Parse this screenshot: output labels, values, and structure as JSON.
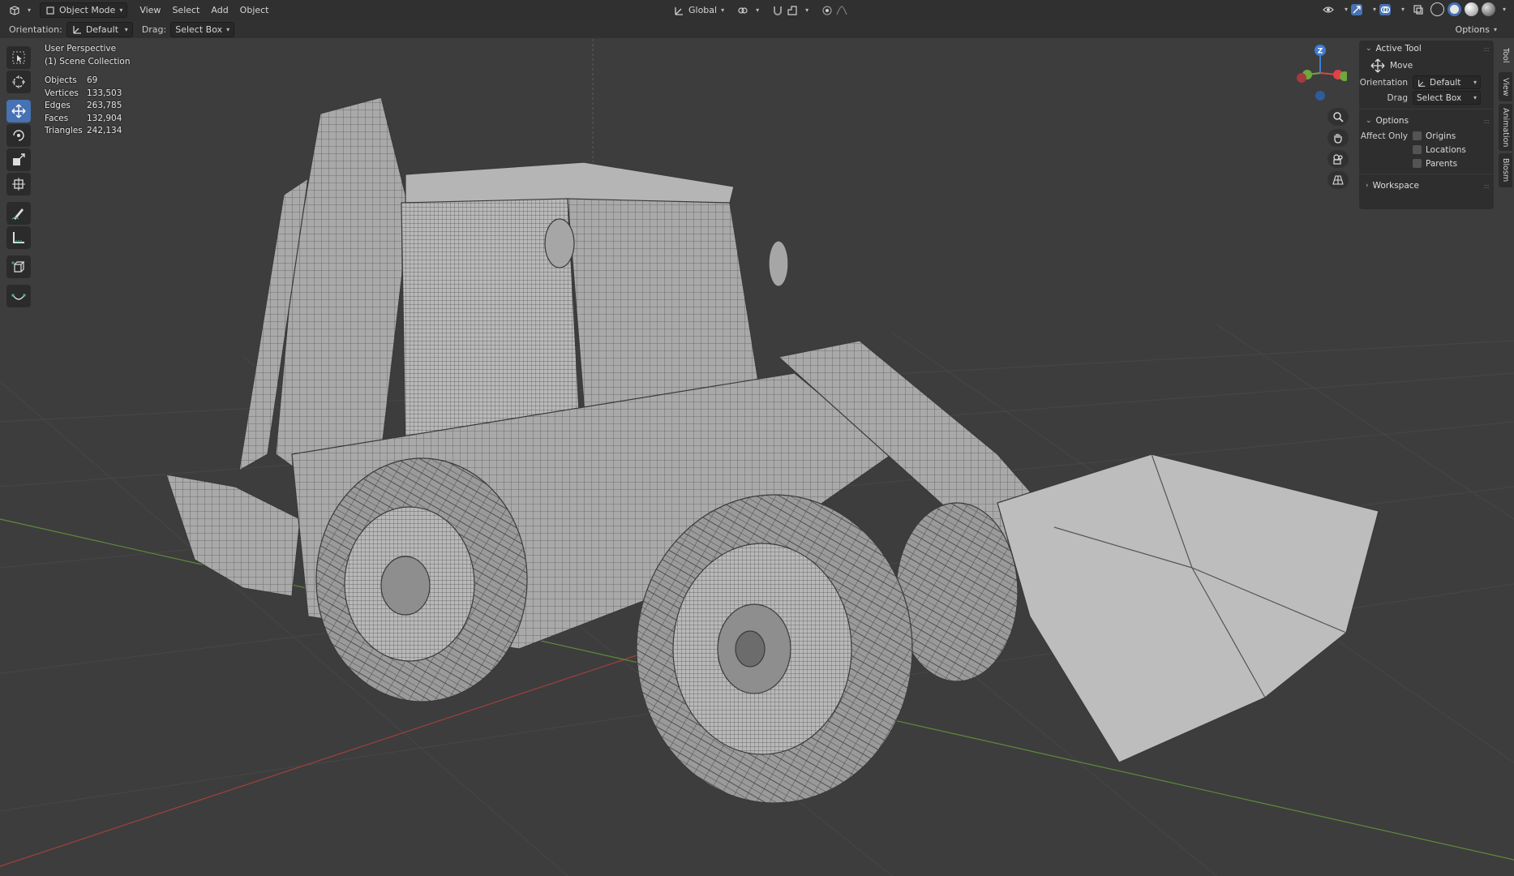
{
  "header": {
    "editor_type_icon": "3d-viewport-icon",
    "mode": "Object Mode",
    "menus": [
      "View",
      "Select",
      "Add",
      "Object"
    ],
    "transform_orientation": "Global",
    "shading_modes": [
      "wireframe",
      "solid",
      "material-preview",
      "rendered"
    ],
    "active_shading": "solid"
  },
  "tool_options": {
    "orientation_label": "Orientation:",
    "orientation_value": "Default",
    "drag_label": "Drag:",
    "drag_value": "Select Box",
    "options_label": "Options"
  },
  "toolbar": {
    "tools": [
      {
        "name": "select-box",
        "icon": "select-box-icon",
        "active": false
      },
      {
        "name": "cursor",
        "icon": "cursor-icon",
        "active": false
      },
      {
        "name": "move",
        "icon": "move-icon",
        "active": true
      },
      {
        "name": "rotate",
        "icon": "rotate-icon",
        "active": false
      },
      {
        "name": "scale",
        "icon": "scale-icon",
        "active": false
      },
      {
        "name": "transform",
        "icon": "transform-icon",
        "active": false
      },
      {
        "name": "annotate",
        "icon": "annotate-icon",
        "active": false
      },
      {
        "name": "measure",
        "icon": "measure-icon",
        "active": false
      },
      {
        "name": "add-cube",
        "icon": "add-cube-icon",
        "active": false
      },
      {
        "name": "curve",
        "icon": "curve-icon",
        "active": false
      }
    ]
  },
  "overlay": {
    "perspective": "User Perspective",
    "collection": "(1) Scene Collection",
    "stats": [
      {
        "label": "Objects",
        "value": "69"
      },
      {
        "label": "Vertices",
        "value": "133,503"
      },
      {
        "label": "Edges",
        "value": "263,785"
      },
      {
        "label": "Faces",
        "value": "132,904"
      },
      {
        "label": "Triangles",
        "value": "242,134"
      }
    ]
  },
  "gizmo": {
    "z_label": "Z",
    "colors": {
      "x": "#e0414a",
      "y": "#6fa83c",
      "z": "#3d7fd6"
    }
  },
  "sidebar": {
    "active_tool_header": "Active Tool",
    "tool_name": "Move",
    "orientation_label": "Orientation",
    "orientation_value": "Default",
    "drag_label": "Drag",
    "drag_value": "Select Box",
    "options_header": "Options",
    "affect_only_label": "Affect Only",
    "affect_options": [
      "Origins",
      "Locations",
      "Parents"
    ],
    "workspace_header": "Workspace",
    "tabs": [
      "Tool",
      "View",
      "Animation",
      "Blosm"
    ],
    "active_tab": "Tool"
  },
  "colors": {
    "accent": "#4772b3",
    "viewport_bg": "#3d3d3d",
    "header_bg": "#303030",
    "axis_x": "#a0403c",
    "axis_y": "#5e8a3a"
  }
}
